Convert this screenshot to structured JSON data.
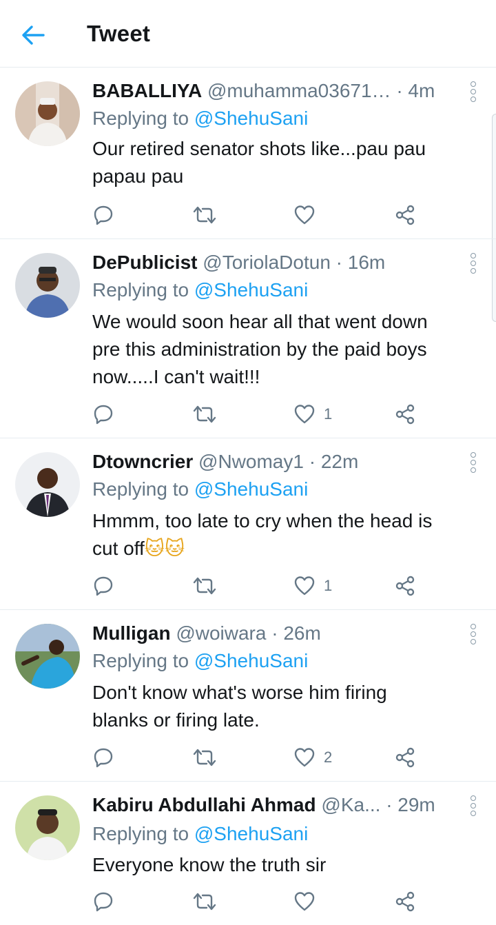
{
  "header": {
    "title": "Tweet"
  },
  "reply_prefix": "Replying to ",
  "tweets": [
    {
      "name": "BABALLIYA",
      "handle": "@muhamma03671…",
      "time": "· 4m",
      "reply_to": "@ShehuSani",
      "text_lines": [
        "Our retired senator shots like...pau pau",
        "papau pau"
      ],
      "likes": ""
    },
    {
      "name": "DePublicist",
      "handle": "@ToriolaDotun",
      "time": "· 16m",
      "reply_to": "@ShehuSani",
      "text_lines": [
        "We would soon hear all that went down",
        "pre this administration by the paid boys",
        "now.....I can't wait!!!"
      ],
      "likes": "1"
    },
    {
      "name": "Dtowncrier",
      "handle": "@Nwomay1",
      "time": "· 22m",
      "reply_to": "@ShehuSani",
      "text_lines": [
        "Hmmm, too late to cry when the head is",
        "cut off"
      ],
      "emoji": "🐱🐱",
      "likes": "1"
    },
    {
      "name": "Mulligan",
      "handle": "@woiwara",
      "time": "· 26m",
      "reply_to": "@ShehuSani",
      "text_lines": [
        "Don't know what's worse him firing",
        "blanks or firing late."
      ],
      "likes": "2"
    },
    {
      "name": "Kabiru Abdullahi Ahmad",
      "handle": "@Ka...",
      "time": "· 29m",
      "reply_to": "@ShehuSani",
      "text_lines": [
        "Everyone know the truth sir"
      ],
      "likes": ""
    }
  ],
  "icons": {
    "back": "arrow-left-icon",
    "reply": "reply-icon",
    "retweet": "retweet-icon",
    "like": "heart-icon",
    "share": "share-icon",
    "more": "more-vertical-icon"
  },
  "colors": {
    "accent": "#1da1f2",
    "secondary_text": "#657786",
    "divider": "#e6ecf0"
  }
}
